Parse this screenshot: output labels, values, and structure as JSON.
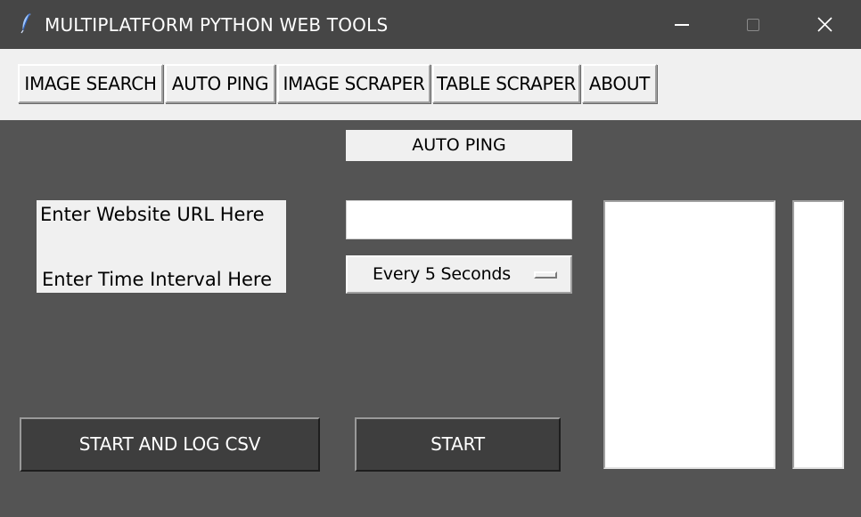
{
  "window": {
    "title": "MULTIPLATFORM PYTHON WEB TOOLS",
    "app_icon": "feather-icon",
    "controls": [
      "minimize-icon",
      "maximize-icon",
      "close-icon"
    ]
  },
  "nav": {
    "tabs": [
      {
        "label": "IMAGE SEARCH"
      },
      {
        "label": "AUTO PING"
      },
      {
        "label": "IMAGE SCRAPER"
      },
      {
        "label": "TABLE SCRAPER"
      },
      {
        "label": "ABOUT"
      }
    ]
  },
  "page": {
    "heading": "AUTO PING",
    "url_label": "Enter Website URL Here",
    "interval_label": "Enter Time Interval Here",
    "url_input": {
      "value": "",
      "placeholder": ""
    },
    "interval_select": {
      "selected": "Every 5 Seconds"
    },
    "start_log_button": "START AND LOG CSV",
    "start_button": "START"
  },
  "colors": {
    "window_bg": "#545454",
    "titlebar_bg": "#464646",
    "panel_bg": "#f0f0f0",
    "dark_button_bg": "#3e3e3e"
  }
}
